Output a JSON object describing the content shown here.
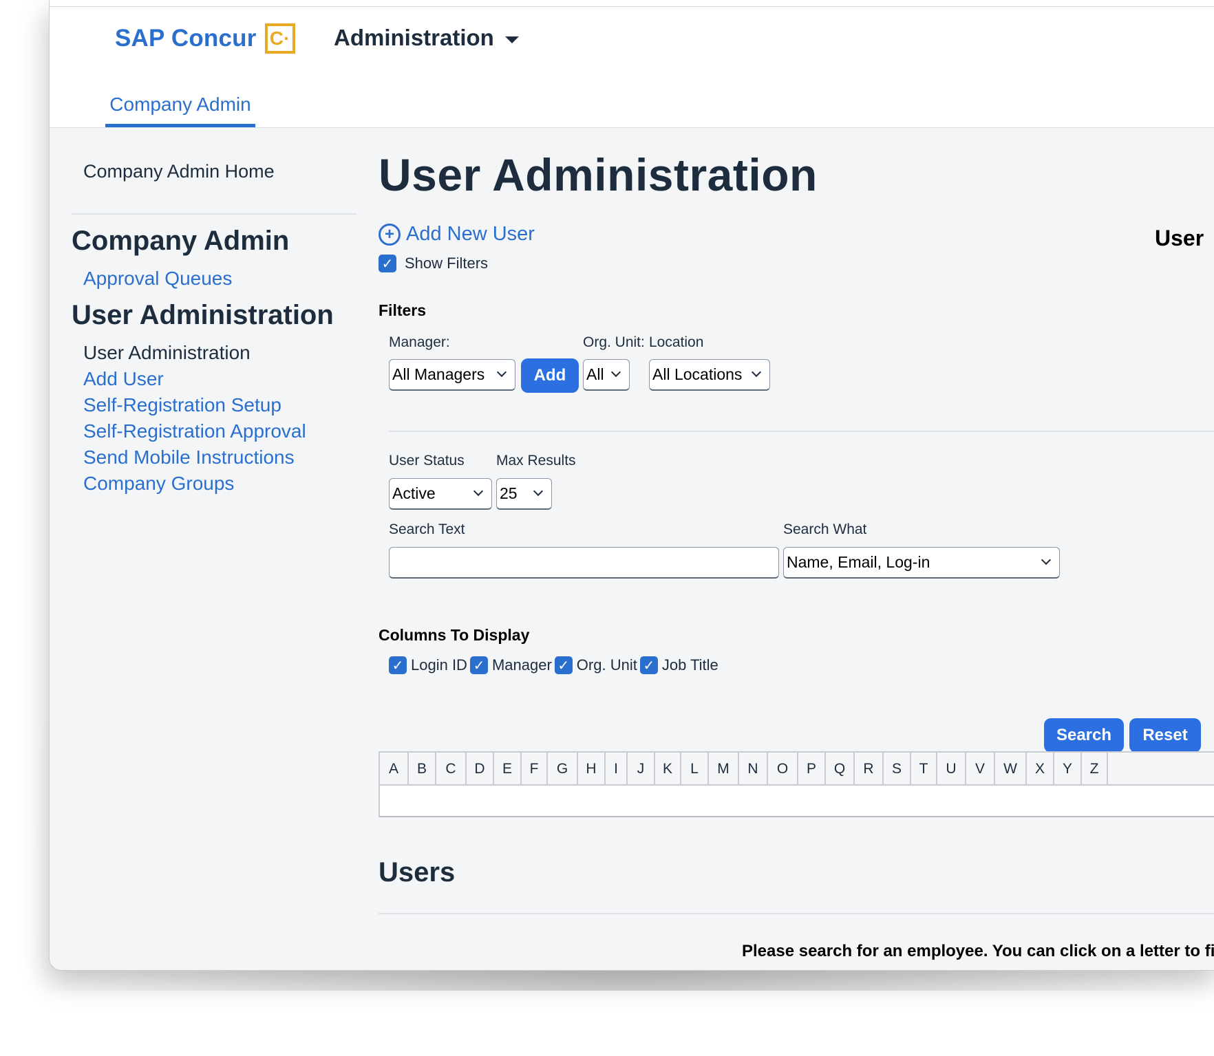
{
  "header": {
    "logo_text": "SAP Concur",
    "logo_mark": "C·",
    "menu_title": "Administration",
    "tab": "Company Admin"
  },
  "sidebar": {
    "home": "Company Admin Home",
    "section1_title": "Company Admin",
    "section1_links": [
      "Approval Queues"
    ],
    "section2_title": "User Administration",
    "current": "User Administration",
    "section2_links": [
      "Add User",
      "Self-Registration Setup",
      "Self-Registration Approval",
      "Send Mobile Instructions",
      "Company Groups"
    ]
  },
  "main": {
    "title": "User Administration",
    "add_new_user": "Add New User",
    "right_title": "User",
    "show_filters": "Show Filters",
    "filters_label": "Filters",
    "manager_label": "Manager:",
    "manager_value": "All Managers",
    "add_button": "Add",
    "org_unit_label": "Org. Unit:",
    "org_unit_value": "All",
    "location_label": "Location",
    "location_value": "All Locations",
    "user_status_label": "User Status",
    "user_status_value": "Active",
    "max_results_label": "Max Results",
    "max_results_value": "25",
    "search_text_label": "Search Text",
    "search_text_value": "",
    "search_what_label": "Search What",
    "search_what_value": "Name, Email, Log-in",
    "columns_label": "Columns To Display",
    "columns": [
      "Login ID",
      "Manager",
      "Org. Unit",
      "Job Title"
    ],
    "search_button": "Search",
    "reset_button": "Reset",
    "letters": [
      "A",
      "B",
      "C",
      "D",
      "E",
      "F",
      "G",
      "H",
      "I",
      "J",
      "K",
      "L",
      "M",
      "N",
      "O",
      "P",
      "Q",
      "R",
      "S",
      "T",
      "U",
      "V",
      "W",
      "X",
      "Y",
      "Z"
    ],
    "users_heading": "Users",
    "message": "Please search for an employee. You can click on a letter to fi"
  },
  "colors": {
    "accent": "#2b6fce",
    "button": "#2b6fe0",
    "logo_box": "#e8a923",
    "text_dark": "#1d2d3e"
  }
}
